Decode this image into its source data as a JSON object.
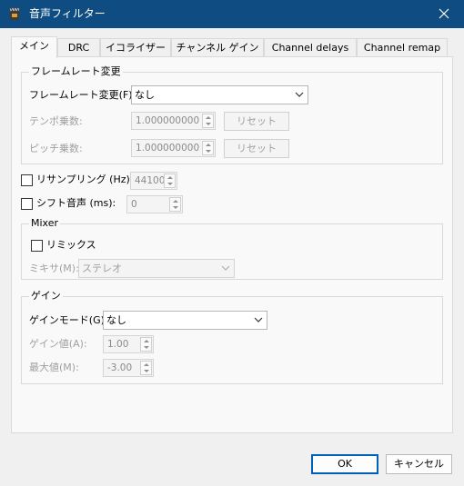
{
  "window": {
    "title": "音声フィルター"
  },
  "tabs": [
    {
      "label": "メイン"
    },
    {
      "label": "DRC"
    },
    {
      "label": "イコライザー"
    },
    {
      "label": "チャンネル ゲイン"
    },
    {
      "label": "Channel delays"
    },
    {
      "label": "Channel remap"
    }
  ],
  "framerate": {
    "group_label": "フレームレート変更",
    "change_label": "フレームレート変更(F):",
    "change_value": "なし",
    "tempo_label": "テンポ乗数:",
    "tempo_value": "1.000000000",
    "tempo_reset": "リセット",
    "pitch_label": "ピッチ乗数:",
    "pitch_value": "1.000000000",
    "pitch_reset": "リセット"
  },
  "resampling": {
    "label": "リサンプリング (Hz):",
    "value": "44100"
  },
  "shift": {
    "label": "シフト音声 (ms):",
    "value": "0"
  },
  "mixer": {
    "group_label": "Mixer",
    "remix_label": "リミックス",
    "mixer_label": "ミキサ(M):",
    "mixer_value": "ステレオ"
  },
  "gain": {
    "group_label": "ゲイン",
    "mode_label": "ゲインモード(G):",
    "mode_value": "なし",
    "value_label": "ゲイン値(A):",
    "value": "1.00",
    "max_label": "最大値(M):",
    "max_value": "-3.00"
  },
  "footer": {
    "ok_label": "OK",
    "cancel_label": "キャンセル"
  },
  "colors": {
    "titlebar": "#0f4c82",
    "accent": "#005fb8"
  }
}
